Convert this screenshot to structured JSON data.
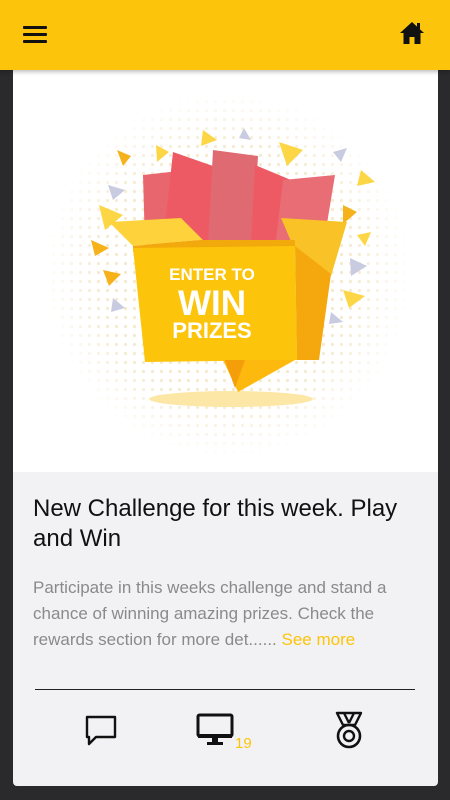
{
  "topbar": {
    "menu_icon": "hamburger-menu-icon",
    "home_icon": "home-icon",
    "color": "#fcc40a"
  },
  "post": {
    "image": {
      "line1": "ENTER TO",
      "line2": "WIN",
      "line3": "PRIZES"
    },
    "title": "New Challenge for this week. Play and Win",
    "description": "Participate in this weeks challenge and stand a chance of winning amazing prizes. Check the rewards section for more det......",
    "see_more": "See more",
    "actions": {
      "comment_icon": "comment-icon",
      "view_icon": "monitor-icon",
      "view_count": "19",
      "reward_icon": "medal-icon"
    }
  }
}
